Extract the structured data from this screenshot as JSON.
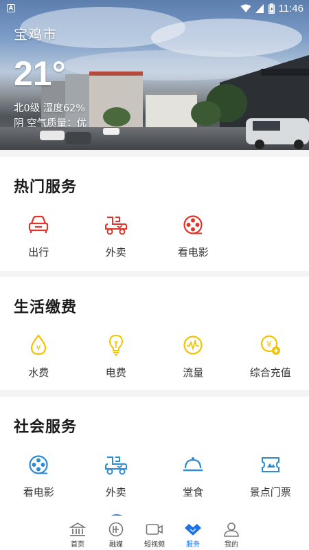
{
  "status": {
    "time": "11:46",
    "notif": "A"
  },
  "weather": {
    "city": "宝鸡市",
    "temp": "21°",
    "line1": "北0级 湿度62%",
    "line2": "阴 空气质量：优"
  },
  "hot": {
    "title": "热门服务",
    "items": [
      {
        "label": "出行",
        "icon": "car-icon"
      },
      {
        "label": "外卖",
        "icon": "delivery-icon"
      },
      {
        "label": "看电影",
        "icon": "film-reel-icon"
      }
    ]
  },
  "life": {
    "title": "生活缴费",
    "items": [
      {
        "label": "水费",
        "icon": "water-drop-yuan-icon"
      },
      {
        "label": "电费",
        "icon": "lightbulb-icon"
      },
      {
        "label": "流量",
        "icon": "data-pulse-icon"
      },
      {
        "label": "综合充值",
        "icon": "yuan-recharge-icon"
      }
    ]
  },
  "social": {
    "title": "社会服务",
    "items": [
      {
        "label": "看电影",
        "icon": "film-reel-icon"
      },
      {
        "label": "外卖",
        "icon": "delivery-icon"
      },
      {
        "label": "堂食",
        "icon": "cloche-icon"
      },
      {
        "label": "景点门票",
        "icon": "ticket-icon"
      }
    ]
  },
  "tabs": [
    {
      "label": "首页",
      "icon": "bank-icon"
    },
    {
      "label": "融媒",
      "icon": "media-icon"
    },
    {
      "label": "短视频",
      "icon": "video-icon"
    },
    {
      "label": "服务",
      "icon": "handshake-icon",
      "active": true
    },
    {
      "label": "我的",
      "icon": "user-icon"
    }
  ],
  "colors": {
    "red": "#e0342b",
    "yellow": "#f2c300",
    "blue": "#2a8bd6",
    "active_tab": "#1a73e8"
  }
}
